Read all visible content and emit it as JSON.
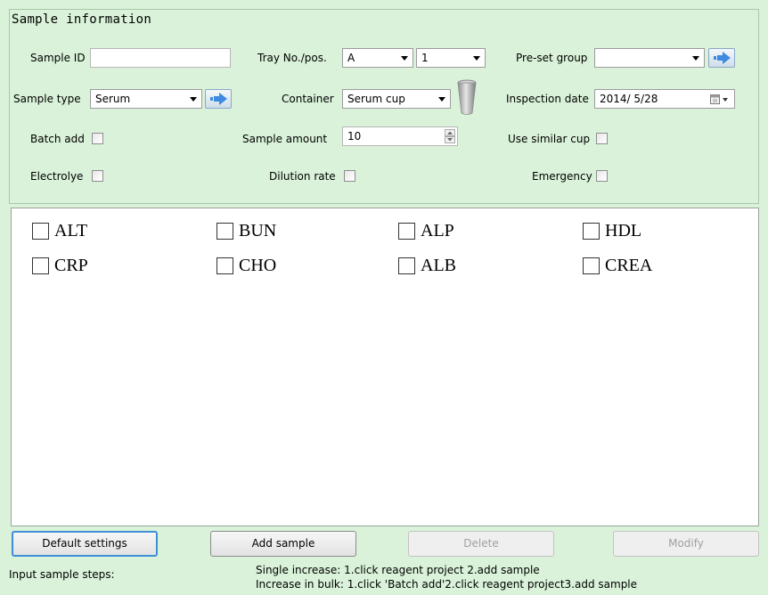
{
  "section_title": "Sample information",
  "form": {
    "sample_id": {
      "label": "Sample ID",
      "value": ""
    },
    "tray": {
      "label": "Tray No./pos.",
      "tray_value": "A",
      "pos_value": "1"
    },
    "preset_group": {
      "label": "Pre-set group",
      "value": ""
    },
    "sample_type": {
      "label": "Sample type",
      "value": "Serum"
    },
    "container": {
      "label": "Container",
      "value": "Serum cup"
    },
    "inspection_date": {
      "label": "Inspection date",
      "value": "2014/ 5/28"
    },
    "batch_add": {
      "label": "Batch add",
      "checked": false
    },
    "sample_amount": {
      "label": "Sample amount",
      "value": "10"
    },
    "use_similar_cup": {
      "label": "Use similar cup",
      "checked": false
    },
    "electrolye": {
      "label": "Electrolye",
      "checked": false
    },
    "dilution_rate": {
      "label": "Dilution rate",
      "checked": false
    },
    "emergency": {
      "label": "Emergency",
      "checked": false
    }
  },
  "test_items": [
    {
      "label": "ALT",
      "checked": false
    },
    {
      "label": "BUN",
      "checked": false
    },
    {
      "label": "ALP",
      "checked": false
    },
    {
      "label": "HDL",
      "checked": false
    },
    {
      "label": "CRP",
      "checked": false
    },
    {
      "label": "CHO",
      "checked": false
    },
    {
      "label": "ALB",
      "checked": false
    },
    {
      "label": "CREA",
      "checked": false
    }
  ],
  "buttons": {
    "default_settings": "Default settings",
    "add_sample": "Add sample",
    "delete": "Delete",
    "modify": "Modify"
  },
  "footer": {
    "steps_label": "Input sample steps:",
    "single_increase": "Single increase: 1.click reagent project 2.add sample",
    "bulk_increase": "Increase in bulk: 1.click 'Batch add'2.click reagent project3.add sample"
  },
  "icons": {
    "arrow_button": "arrow-right-icon",
    "container": "cup-icon",
    "date_picker": "calendar-icon",
    "spinner": "spinner-arrows-icon"
  },
  "colors": {
    "background": "#d9f2d9",
    "primary_button_border": "#3f8fd8",
    "arrow_icon": "#3d8be0"
  }
}
